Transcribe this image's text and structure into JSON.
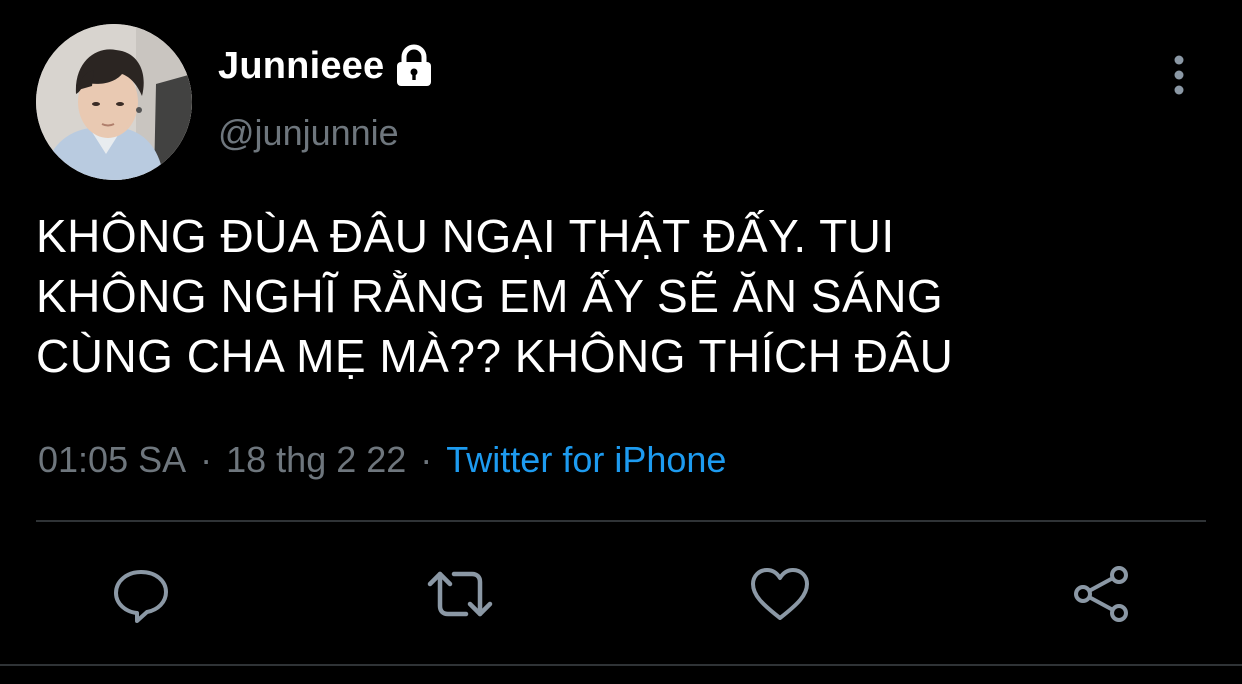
{
  "tweet": {
    "display_name": "Junnieee",
    "handle": "@junjunnie",
    "protected_icon": "lock-icon",
    "text_lines": [
      "KHÔNG ĐÙA ĐÂU NGẠI THẬT ĐẤY. TUI",
      "KHÔNG NGHĨ RẰNG EM ẤY SẼ ĂN SÁNG",
      "CÙNG CHA MẸ MÀ?? KHÔNG THÍCH ĐÂU"
    ],
    "time": "01:05 SA",
    "date": "18 thg 2 22",
    "separator": "·",
    "source": "Twitter for iPhone"
  },
  "actions": [
    {
      "name": "reply",
      "icon": "reply-icon"
    },
    {
      "name": "retweet",
      "icon": "retweet-icon"
    },
    {
      "name": "like",
      "icon": "heart-icon"
    },
    {
      "name": "share",
      "icon": "share-icon"
    }
  ],
  "colors": {
    "background": "#000000",
    "text": "#ffffff",
    "secondary_text": "#6e767d",
    "link": "#1d9bf0",
    "icon": "#8b98a5",
    "divider": "#2f3336"
  }
}
